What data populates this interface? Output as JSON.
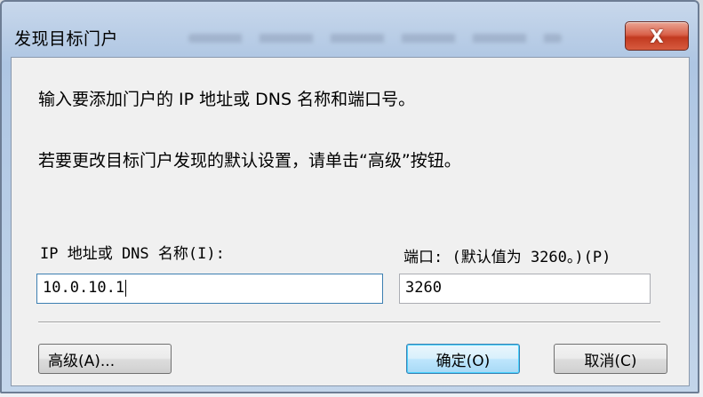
{
  "window": {
    "title": "发现目标门户",
    "close_glyph": "X"
  },
  "messages": {
    "line1": "输入要添加门户的 IP 地址或 DNS 名称和端口号。",
    "line2": "若要更改目标门户发现的默认设置，请单击“高级”按钮。"
  },
  "fields": {
    "ip_label": "IP 地址或 DNS 名称(I):",
    "ip_value": "10.0.10.1",
    "port_label": "端口: (默认值为 3260。)(P)",
    "port_value": "3260"
  },
  "buttons": {
    "advanced": "高级(A)...",
    "ok": "确定(O)",
    "cancel": "取消(C)"
  },
  "colors": {
    "close_button": "#c23a20",
    "focus_border": "#3c7fb1"
  }
}
